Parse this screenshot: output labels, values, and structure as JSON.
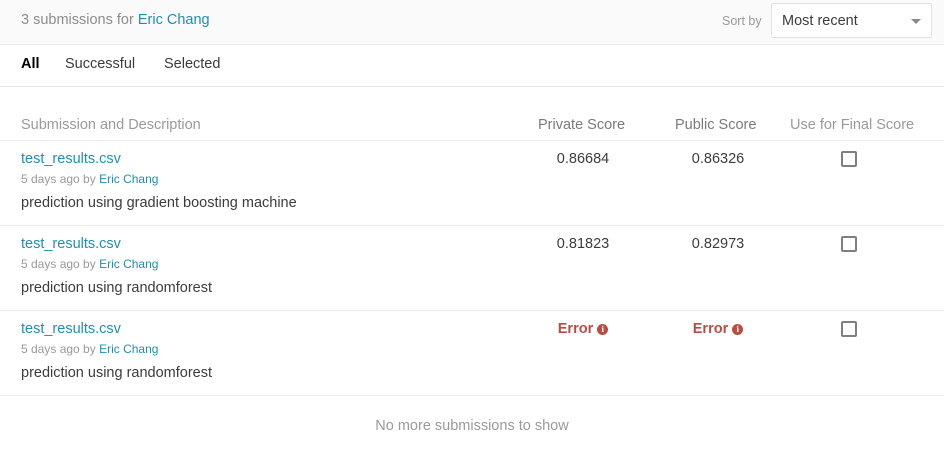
{
  "header": {
    "count_text": "3 submissions for",
    "owner_name": "Eric Chang",
    "sort_label": "Sort by",
    "sort_value": "Most recent"
  },
  "tabs": [
    {
      "label": "All",
      "active": true
    },
    {
      "label": "Successful",
      "active": false
    },
    {
      "label": "Selected",
      "active": false
    }
  ],
  "table": {
    "columns": [
      "Submission and Description",
      "Private Score",
      "Public Score",
      "Use for Final Score"
    ],
    "rows": [
      {
        "file": "test_results.csv",
        "time": "5 days ago by",
        "author": "Eric Chang",
        "description": "prediction using gradient boosting machine",
        "private_score": "0.86684",
        "public_score": "0.86326"
      },
      {
        "file": "test_results.csv",
        "time": "5 days ago by",
        "author": "Eric Chang",
        "description": "prediction using randomforest",
        "private_score": "0.81823",
        "public_score": "0.82973"
      },
      {
        "file": "test_results.csv",
        "time": "5 days ago by",
        "author": "Eric Chang",
        "description": "prediction using randomforest",
        "private_score": "Error",
        "public_score": "Error"
      }
    ]
  },
  "footer_text": "No more submissions to show",
  "colors": {
    "link": "#1f8fb0",
    "error": "#b84d43"
  },
  "icons": {
    "error_info": "info-circle-icon",
    "sort_caret": "caret-down-icon"
  }
}
